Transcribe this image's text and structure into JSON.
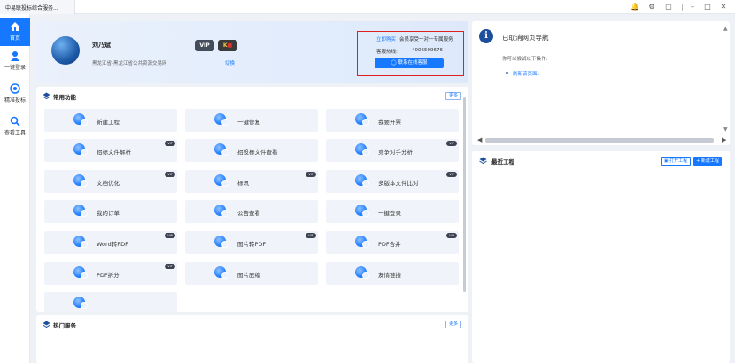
{
  "window": {
    "app_tab": "中易联投标综合服务..."
  },
  "sidebar": {
    "items": [
      {
        "label": "首页"
      },
      {
        "label": "一键登录"
      },
      {
        "label": "精准投标"
      },
      {
        "label": "查看工具"
      }
    ]
  },
  "profile": {
    "name": "刘乃斌",
    "location": "黑龙江省-黑龙江省公共资源交易网",
    "badge_vip": "VIP",
    "badge_k": "K",
    "switch": "切换"
  },
  "service": {
    "buy": "立即购买",
    "desc": "会员享受一对一专属服务",
    "hotline_label": "客服热线:",
    "hotline": "4006509676",
    "contact_button": "联系在线客服"
  },
  "common": {
    "title": "常用功能",
    "more": "更多",
    "items": [
      {
        "label": "新建工程",
        "vip": ""
      },
      {
        "label": "一键修复",
        "vip": ""
      },
      {
        "label": "我要开票",
        "vip": ""
      },
      {
        "label": "招标文件解析",
        "vip": "VIP"
      },
      {
        "label": "招投标文件查看",
        "vip": ""
      },
      {
        "label": "竞争对手分析",
        "vip": "VIP"
      },
      {
        "label": "文档优化",
        "vip": "VIP"
      },
      {
        "label": "标讯",
        "vip": "VIP"
      },
      {
        "label": "多版本文件比对",
        "vip": "VIP"
      },
      {
        "label": "我的订单",
        "vip": ""
      },
      {
        "label": "公告查看",
        "vip": ""
      },
      {
        "label": "一键登录",
        "vip": ""
      },
      {
        "label": "Word转PDF",
        "vip": "VIP"
      },
      {
        "label": "图片转PDF",
        "vip": "VIP"
      },
      {
        "label": "PDF合并",
        "vip": "VIP"
      },
      {
        "label": "PDF拆分",
        "vip": "VIP"
      },
      {
        "label": "图片压缩",
        "vip": ""
      },
      {
        "label": "友情链接",
        "vip": ""
      }
    ]
  },
  "hot": {
    "title": "热门服务",
    "more": "更多"
  },
  "webnav": {
    "title": "已取消网页导航",
    "line1": "你可以尝试以下操作:",
    "refresh": "刷新该页面。"
  },
  "recent": {
    "title": "最近工程",
    "open": "打开工程",
    "new": "+ 新建工程"
  },
  "colors": {
    "accent": "#1677ff",
    "highlight_border": "#e02020"
  }
}
